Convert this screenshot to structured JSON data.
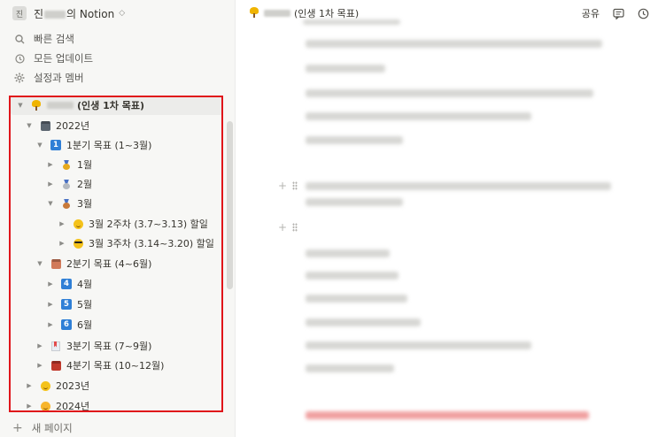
{
  "workspace": {
    "avatar_letter": "진",
    "name_prefix": "진",
    "name_suffix": "의 Notion",
    "chevron": "◇"
  },
  "nav": [
    {
      "label": "빠른 검색",
      "icon": "search-icon"
    },
    {
      "label": "모든 업데이트",
      "icon": "clock-icon"
    },
    {
      "label": "설정과 멤버",
      "icon": "gear-icon"
    }
  ],
  "tree": [
    {
      "label": "(인생 1차 목표)",
      "icon": "tree-icon",
      "arrow": "▼",
      "blurred_prefix": true,
      "selected": true
    },
    {
      "label": "2022년",
      "icon": "calendar-icon",
      "arrow": "▼",
      "icon_color": "#5c6670"
    },
    {
      "label": "1분기 목표 (1~3월)",
      "icon": "keycap-1-icon",
      "arrow": "▼",
      "icon_color": "#2f7fd6",
      "icon_text": "1"
    },
    {
      "label": "1월",
      "icon": "gold-medal-icon",
      "arrow": "▶"
    },
    {
      "label": "2월",
      "icon": "silver-medal-icon",
      "arrow": "▶"
    },
    {
      "label": "3월",
      "icon": "bronze-medal-icon",
      "arrow": "▼"
    },
    {
      "label": "3월 2주차 (3.7~3.13) 할일",
      "icon": "smiley-icon",
      "arrow": "▶"
    },
    {
      "label": "3월 3주차 (3.14~3.20) 할일",
      "icon": "sunglasses-icon",
      "arrow": "▶"
    },
    {
      "label": "2분기 목표 (4~6월)",
      "icon": "calendar-icon",
      "arrow": "▼",
      "icon_color": "#d17a5a"
    },
    {
      "label": "4월",
      "icon": "keycap-4-icon",
      "arrow": "▶",
      "icon_color": "#2f7fd6",
      "icon_text": "4"
    },
    {
      "label": "5월",
      "icon": "keycap-5-icon",
      "arrow": "▶",
      "icon_color": "#2f7fd6",
      "icon_text": "5"
    },
    {
      "label": "6월",
      "icon": "keycap-6-icon",
      "arrow": "▶",
      "icon_color": "#2f7fd6",
      "icon_text": "6"
    },
    {
      "label": "3분기 목표 (7~9월)",
      "icon": "bookmark-icon",
      "arrow": "▶"
    },
    {
      "label": "4분기 목표 (10~12월)",
      "icon": "calendar-icon",
      "arrow": "▶",
      "icon_color": "#c0392b"
    },
    {
      "label": "2023년",
      "icon": "smiley-icon",
      "arrow": "▶"
    },
    {
      "label": "2024년",
      "icon": "grin-icon",
      "arrow": "▶"
    }
  ],
  "new_page_label": "새 페이지",
  "topbar": {
    "breadcrumb": "(인생 1차 목표)",
    "share_label": "공유"
  },
  "colors": {
    "highlight_box": "#e0151a",
    "sidebar_bg": "#f7f7f5"
  }
}
